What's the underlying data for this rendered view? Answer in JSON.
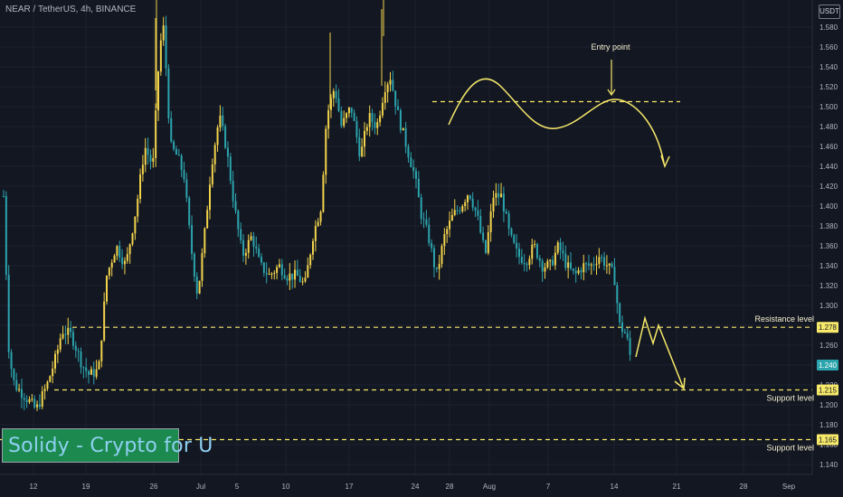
{
  "symbol": {
    "title": "NEAR / TetherUS, 4h, BINANCE"
  },
  "currency_badge": "USDT",
  "watermark": "Solidy - Crypto for U",
  "colors": {
    "background": "#131722",
    "candle_up": "#f2d34b",
    "candle_down": "#2ba4ad",
    "annotation": "#f7e96a",
    "axis_text": "#b2b5be"
  },
  "chart_data": {
    "type": "candlestick",
    "ylim": [
      1.13,
      1.6
    ],
    "y_ticks": [
      "1.580",
      "1.560",
      "1.540",
      "1.520",
      "1.500",
      "1.480",
      "1.460",
      "1.440",
      "1.420",
      "1.400",
      "1.380",
      "1.360",
      "1.340",
      "1.320",
      "1.300",
      "1.280",
      "1.260",
      "1.240",
      "1.220",
      "1.200",
      "1.180",
      "1.160",
      "1.140"
    ],
    "x_ticks": [
      "12",
      "19",
      "26",
      "Jul",
      "5",
      "10",
      "17",
      "24",
      "28",
      "Aug",
      "7",
      "14",
      "21",
      "28",
      "Sep"
    ],
    "price_path": [
      [
        0,
        1.41
      ],
      [
        0.4,
        1.25
      ],
      [
        0.8,
        1.22
      ],
      [
        1.5,
        1.21
      ],
      [
        2.4,
        1.195
      ],
      [
        3.2,
        1.22
      ],
      [
        3.9,
        1.25
      ],
      [
        4.3,
        1.275
      ],
      [
        5.0,
        1.27
      ],
      [
        5.8,
        1.24
      ],
      [
        6.3,
        1.23
      ],
      [
        7.0,
        1.235
      ],
      [
        7.6,
        1.33
      ],
      [
        8.3,
        1.36
      ],
      [
        9.0,
        1.34
      ],
      [
        9.8,
        1.4
      ],
      [
        10.4,
        1.46
      ],
      [
        11.0,
        1.44
      ],
      [
        11.5,
        1.56
      ],
      [
        11.8,
        1.58
      ],
      [
        12.3,
        1.46
      ],
      [
        12.8,
        1.45
      ],
      [
        13.3,
        1.43
      ],
      [
        13.8,
        1.36
      ],
      [
        14.3,
        1.31
      ],
      [
        14.8,
        1.37
      ],
      [
        15.3,
        1.44
      ],
      [
        15.9,
        1.49
      ],
      [
        16.4,
        1.46
      ],
      [
        17.0,
        1.4
      ],
      [
        17.6,
        1.35
      ],
      [
        18.3,
        1.37
      ],
      [
        18.9,
        1.34
      ],
      [
        19.6,
        1.33
      ],
      [
        20.3,
        1.34
      ],
      [
        20.9,
        1.33
      ],
      [
        21.6,
        1.33
      ],
      [
        22.2,
        1.32
      ],
      [
        22.8,
        1.37
      ],
      [
        23.4,
        1.4
      ],
      [
        23.8,
        1.49
      ],
      [
        24.4,
        1.52
      ],
      [
        24.9,
        1.48
      ],
      [
        25.6,
        1.5
      ],
      [
        26.3,
        1.45
      ],
      [
        26.9,
        1.49
      ],
      [
        27.5,
        1.48
      ],
      [
        28.1,
        1.52
      ],
      [
        28.5,
        1.53
      ],
      [
        29.1,
        1.49
      ],
      [
        29.7,
        1.46
      ],
      [
        30.3,
        1.43
      ],
      [
        30.8,
        1.39
      ],
      [
        31.3,
        1.37
      ],
      [
        31.9,
        1.33
      ],
      [
        32.5,
        1.37
      ],
      [
        33.1,
        1.39
      ],
      [
        33.7,
        1.4
      ],
      [
        34.3,
        1.415
      ],
      [
        34.9,
        1.39
      ],
      [
        35.5,
        1.35
      ],
      [
        36.1,
        1.41
      ],
      [
        36.7,
        1.41
      ],
      [
        37.3,
        1.37
      ],
      [
        37.9,
        1.35
      ],
      [
        38.5,
        1.345
      ],
      [
        39.1,
        1.36
      ],
      [
        39.7,
        1.34
      ],
      [
        40.3,
        1.34
      ],
      [
        40.9,
        1.36
      ],
      [
        41.5,
        1.34
      ],
      [
        42.1,
        1.33
      ],
      [
        42.7,
        1.34
      ],
      [
        43.3,
        1.34
      ],
      [
        43.9,
        1.35
      ],
      [
        44.5,
        1.34
      ],
      [
        45.0,
        1.33
      ],
      [
        45.4,
        1.28
      ],
      [
        45.9,
        1.27
      ],
      [
        46.3,
        1.24
      ]
    ],
    "annotations": {
      "entry_label": "Entry point",
      "resistance_label": "Resistance level",
      "support_label_1": "Support level",
      "support_label_2": "Support level",
      "resistance_value": 1.278,
      "support_value_1": 1.215,
      "support_value_2": 1.165,
      "entry_value": 1.505,
      "current_value": 1.24,
      "resistance_badge": "1.278",
      "support_badge_1": "1.215",
      "support_badge_2": "1.165",
      "current_badge": "1.240"
    }
  }
}
